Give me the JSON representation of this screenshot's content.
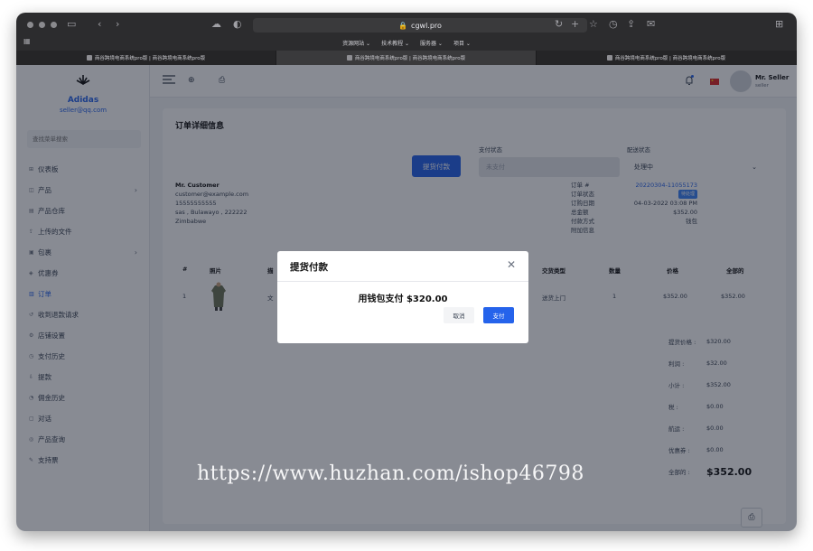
{
  "browser": {
    "url": "cgwl.pro",
    "bookmarks": [
      "资源网站 ⌄",
      "技术教程 ⌄",
      "服务器 ⌄",
      "项目 ⌄"
    ],
    "tabs": [
      {
        "label": "商谷跨境电商系统pro版 | 商谷跨境电商系统pro版",
        "active": false
      },
      {
        "label": "商谷跨境电商系统pro版 | 商谷跨境电商系统pro版",
        "active": true
      },
      {
        "label": "商谷跨境电商系统pro版 | 商谷跨境电商系统pro版",
        "active": false
      }
    ]
  },
  "sidebar": {
    "brand_name": "Adidas",
    "brand_email": "seller@qq.com",
    "search_placeholder": "查找菜单搜索",
    "items": [
      {
        "label": "仪表板",
        "icon": "dashboard-icon",
        "has_children": false,
        "active": false
      },
      {
        "label": "产品",
        "icon": "product-icon",
        "has_children": true,
        "active": false
      },
      {
        "label": "产品仓库",
        "icon": "warehouse-icon",
        "has_children": false,
        "active": false
      },
      {
        "label": "上传的文件",
        "icon": "upload-icon",
        "has_children": false,
        "active": false
      },
      {
        "label": "包裹",
        "icon": "package-icon",
        "has_children": true,
        "active": false
      },
      {
        "label": "优惠券",
        "icon": "coupon-icon",
        "has_children": false,
        "active": false
      },
      {
        "label": "订单",
        "icon": "order-icon",
        "has_children": false,
        "active": true
      },
      {
        "label": "收到退款请求",
        "icon": "refund-icon",
        "has_children": false,
        "active": false
      },
      {
        "label": "店铺设置",
        "icon": "shop-settings-icon",
        "has_children": false,
        "active": false
      },
      {
        "label": "支付历史",
        "icon": "payment-history-icon",
        "has_children": false,
        "active": false
      },
      {
        "label": "提款",
        "icon": "withdraw-icon",
        "has_children": false,
        "active": false
      },
      {
        "label": "佣金历史",
        "icon": "commission-icon",
        "has_children": false,
        "active": false
      },
      {
        "label": "对话",
        "icon": "chat-icon",
        "has_children": false,
        "active": false
      },
      {
        "label": "产品查询",
        "icon": "query-icon",
        "has_children": false,
        "active": false
      },
      {
        "label": "支持票",
        "icon": "ticket-icon",
        "has_children": false,
        "active": false
      }
    ]
  },
  "topbar": {
    "user_name": "Mr. Seller",
    "user_role": "seller"
  },
  "order": {
    "title": "订单详细信息",
    "pickup_button": "提货付款",
    "payment_status_label": "支付状态",
    "payment_status_value": "未支付",
    "delivery_status_label": "配送状态",
    "delivery_status_value": "处理中",
    "customer": {
      "name": "Mr. Customer",
      "email": "customer@example.com",
      "phone": "15555555555",
      "address": "sas , Bulawayo , 222222",
      "country": "Zimbabwe"
    },
    "info": {
      "order_no_label": "订单 #",
      "order_no_value": "20220304-11055173",
      "status_label": "订单状态",
      "status_value": "待处理",
      "date_label": "订购日期",
      "date_value": "04-03-2022 03:08 PM",
      "total_label": "总金额",
      "total_value": "$352.00",
      "payment_label": "付款方式",
      "payment_value": "钱包",
      "extra_label": "附加信息"
    },
    "table": {
      "headers": [
        "#",
        "照片",
        "描",
        "交货类型",
        "数量",
        "价格",
        "全部的"
      ],
      "rows": [
        {
          "index": "1",
          "desc": "文",
          "delivery": "送货上门",
          "qty": "1",
          "price": "$352.00",
          "total": "$352.00"
        }
      ]
    },
    "totals": [
      {
        "label": "提货价格 :",
        "value": "$320.00"
      },
      {
        "label": "利润 :",
        "value": "$32.00"
      },
      {
        "label": "小计 :",
        "value": "$352.00"
      },
      {
        "label": "税 :",
        "value": "$0.00"
      },
      {
        "label": "航运 :",
        "value": "$0.00"
      },
      {
        "label": "优惠券 :",
        "value": "$0.00"
      },
      {
        "label": "全部的 :",
        "value": "$352.00",
        "grand": true
      }
    ]
  },
  "modal": {
    "title": "提货付款",
    "message": "用钱包支付 $320.00",
    "cancel_label": "取消",
    "pay_label": "支付"
  },
  "watermark": "https://www.huzhan.com/ishop46798",
  "colors": {
    "accent": "#2563eb",
    "overlay": "rgba(17,24,39,0.5)"
  }
}
